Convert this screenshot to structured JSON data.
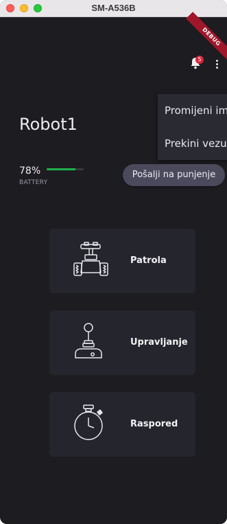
{
  "window": {
    "title": "SM-A536B"
  },
  "debug_banner": "DEBUG",
  "header": {
    "notification_count": "5"
  },
  "menu": {
    "items": [
      {
        "label": "Promijeni ime"
      },
      {
        "label": "Prekini vezu"
      }
    ]
  },
  "robot": {
    "name": "Robot1",
    "battery_percent_text": "78%",
    "battery_level": 0.78,
    "battery_label": "BATTERY",
    "battery_color": "#22b14c"
  },
  "actions": {
    "charge_button": "Pošalji na punjenje"
  },
  "cards": [
    {
      "label": "Patrola",
      "icon": "robot-rover-icon"
    },
    {
      "label": "Upravljanje",
      "icon": "joystick-icon"
    },
    {
      "label": "Raspored",
      "icon": "stopwatch-icon"
    }
  ],
  "colors": {
    "background": "#1c1c21",
    "card": "#25252d",
    "button": "#4a4a5c",
    "badge": "#d7263d"
  }
}
